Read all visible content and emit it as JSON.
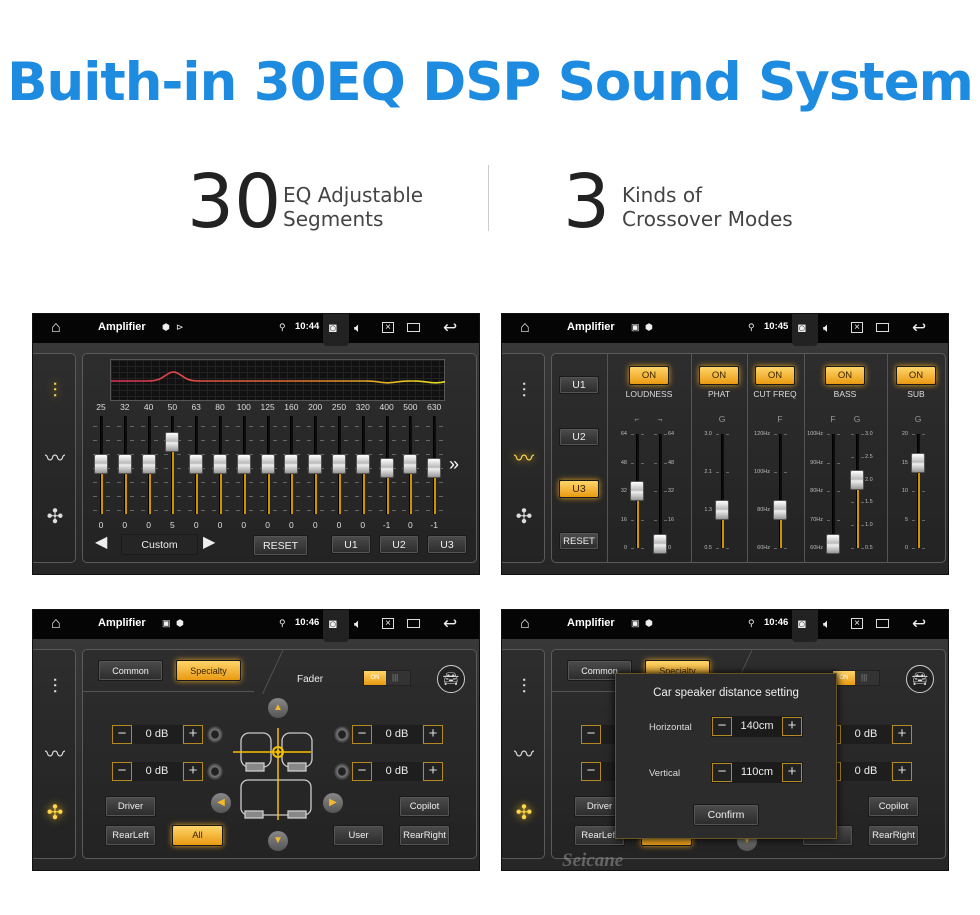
{
  "headline": "Buith-in 30EQ DSP Sound System",
  "stats": [
    {
      "number": "30",
      "line1": "EQ Adjustable",
      "line2": "Segments"
    },
    {
      "number": "3",
      "line1": "Kinds of",
      "line2": "Crossover Modes"
    }
  ],
  "colors": {
    "accent": "#1d8be0",
    "orange": "#f0a820",
    "active_icon": "#ffd54a"
  },
  "screens": [
    {
      "app_title": "Amplifier",
      "time": "10:44",
      "status_icons": [
        "shield-icon",
        "cast-icon"
      ]
    },
    {
      "app_title": "Amplifier",
      "time": "10:45",
      "status_icons": [
        "image-icon",
        "shield-icon"
      ]
    },
    {
      "app_title": "Amplifier",
      "time": "10:46",
      "status_icons": [
        "image-icon",
        "shield-icon"
      ]
    },
    {
      "app_title": "Amplifier",
      "time": "10:46",
      "status_icons": [
        "image-icon",
        "shield-icon"
      ]
    }
  ],
  "eq": {
    "bands": [
      "25",
      "32",
      "40",
      "50",
      "63",
      "80",
      "100",
      "125",
      "160",
      "200",
      "250",
      "320",
      "400",
      "500",
      "630"
    ],
    "values": [
      0,
      0,
      0,
      5,
      0,
      0,
      0,
      0,
      0,
      0,
      0,
      0,
      -1,
      0,
      -1
    ],
    "preset": "Custom",
    "reset": "RESET",
    "user_presets": [
      "U1",
      "U2",
      "U3"
    ]
  },
  "crossover": {
    "presets": [
      "U1",
      "U2",
      "U3"
    ],
    "active_preset": "U3",
    "reset": "RESET",
    "sections": [
      {
        "on": "ON",
        "label": "LOUDNESS",
        "sliders": [
          {
            "head": "⌐",
            "scale": [
              "64",
              "48",
              "32",
              "16",
              "0"
            ],
            "value": "32",
            "side": "left"
          },
          {
            "head": "⌐",
            "scale": [
              "64",
              "48",
              "32",
              "16",
              "0"
            ],
            "value": "0",
            "side": "right"
          }
        ]
      },
      {
        "on": "ON",
        "label": "PHAT",
        "sliders": [
          {
            "head": "G",
            "scale": [
              "3.0",
              "2.1",
              "1.3",
              "0.5"
            ],
            "value": "1.3",
            "side": "left"
          }
        ]
      },
      {
        "on": "ON",
        "label": "CUT FREQ",
        "sliders": [
          {
            "head": "F",
            "scale": [
              "120Hz",
              "100Hz",
              "80Hz",
              "60Hz"
            ],
            "value": "80Hz",
            "side": "left"
          }
        ]
      },
      {
        "on": "ON",
        "label": "BASS",
        "sliders": [
          {
            "head": "F",
            "scale": [
              "100Hz",
              "90Hz",
              "80Hz",
              "70Hz",
              "60Hz"
            ],
            "value": "60Hz",
            "side": "left"
          },
          {
            "head": "G",
            "scale": [
              "3.0",
              "2.5",
              "2.0",
              "1.5",
              "1.0",
              "0.5"
            ],
            "value": "2.0",
            "side": "right"
          }
        ]
      },
      {
        "on": "ON",
        "label": "SUB",
        "sliders": [
          {
            "head": "G",
            "scale": [
              "20",
              "15",
              "10",
              "5",
              "0"
            ],
            "value": "15",
            "side": "left"
          }
        ]
      }
    ]
  },
  "balance": {
    "tabs": [
      "Common",
      "Specialty"
    ],
    "active_tab": "Specialty",
    "fader_label": "Fader",
    "fader_state": "ON",
    "levels": [
      "0 dB",
      "0 dB",
      "0 dB",
      "0 dB"
    ],
    "positions": [
      "Driver",
      "RearLeft",
      "All",
      "User",
      "Copilot",
      "RearRight"
    ],
    "active_position": "All"
  },
  "distance_dialog": {
    "title": "Car speaker distance setting",
    "horizontal_label": "Horizontal",
    "horizontal_value": "140cm",
    "vertical_label": "Vertical",
    "vertical_value": "110cm",
    "confirm": "Confirm"
  },
  "watermark": "Seicane"
}
